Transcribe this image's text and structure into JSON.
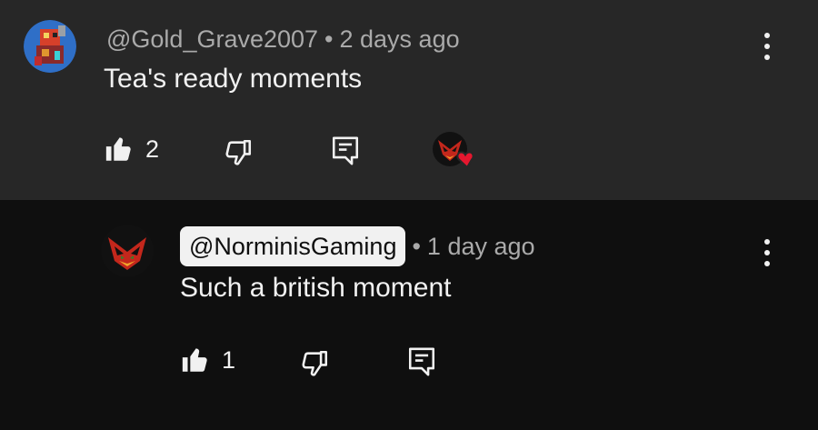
{
  "comment": {
    "author": "@Gold_Grave2007",
    "separator": "•",
    "time": "2 days ago",
    "text": "Tea's ready moments",
    "likes": "2"
  },
  "reply": {
    "author": "@NorminisGaming",
    "separator": "•",
    "time": "1 day ago",
    "text": "Such a british moment",
    "likes": "1"
  },
  "icons": {
    "like": "thumbs-up-icon",
    "dislike": "thumbs-down-icon",
    "reply": "reply-comment-icon",
    "more": "more-vertical-icon",
    "heart": "heart-icon"
  },
  "colors": {
    "top_background": "#272727",
    "reply_background": "#0f0f0f",
    "heart": "#e5172f",
    "meta_text": "#aaaaaa"
  }
}
